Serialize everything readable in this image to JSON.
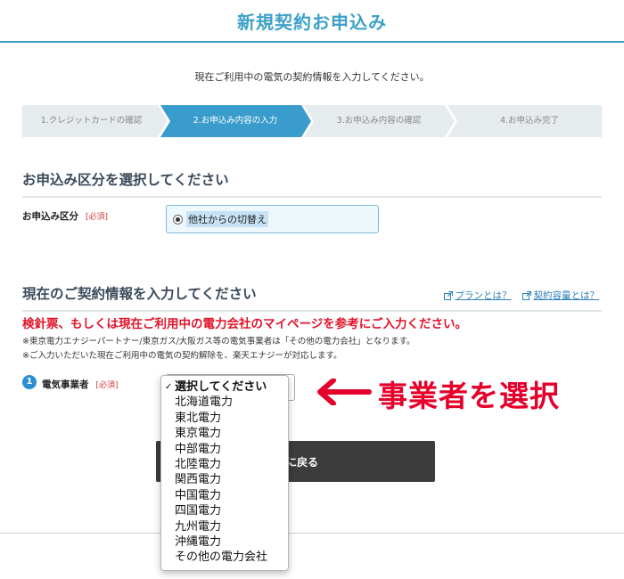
{
  "header": {
    "title": "新規契約お申込み"
  },
  "intro": "現在ご利用中の電気の契約情報を入力してください。",
  "steps": [
    {
      "label": "1.クレジットカードの確認",
      "active": false
    },
    {
      "label": "2.お申込み内容の入力",
      "active": true
    },
    {
      "label": "3.お申込み内容の確認",
      "active": false
    },
    {
      "label": "4.お申込み完了",
      "active": false
    }
  ],
  "section1": {
    "title": "お申込み区分を選択してください",
    "field_label": "お申込み区分",
    "required": "[必須]",
    "radio_option": "他社からの切替え"
  },
  "section2": {
    "title": "現在のご契約情報を入力してください",
    "link_plan": "プランとは？",
    "link_capacity": "契約容量とは？",
    "warning": "検針票、もしくは現在ご利用中の電力会社のマイページを参考にご入力ください。",
    "note1": "※東京電力エナジーパートナー/東京ガス/大阪ガス等の電気事業者は「その他の電力会社」となります。",
    "note2": "※ご入力いただいた現在ご利用中の電気の契約解除を、楽天エナジーが対応します。",
    "field_number": "1",
    "field_label": "電気事業者",
    "required": "[必須]"
  },
  "dropdown": {
    "selected_check": "✓",
    "options": [
      "選択してください",
      "北海道電力",
      "東北電力",
      "東京電力",
      "中部電力",
      "北陸電力",
      "関西電力",
      "中国電力",
      "四国電力",
      "九州電力",
      "沖縄電力",
      "その他の電力会社"
    ]
  },
  "back_button": "に戻る",
  "annotation": {
    "text": "事業者を選択",
    "color": "#e4002b"
  },
  "colors": {
    "accent": "#3da0c9",
    "step_active": "#3a9ccc",
    "warning": "#e0142a"
  },
  "icons": {
    "link": "external-link-icon",
    "step": "chevron-arrow"
  }
}
